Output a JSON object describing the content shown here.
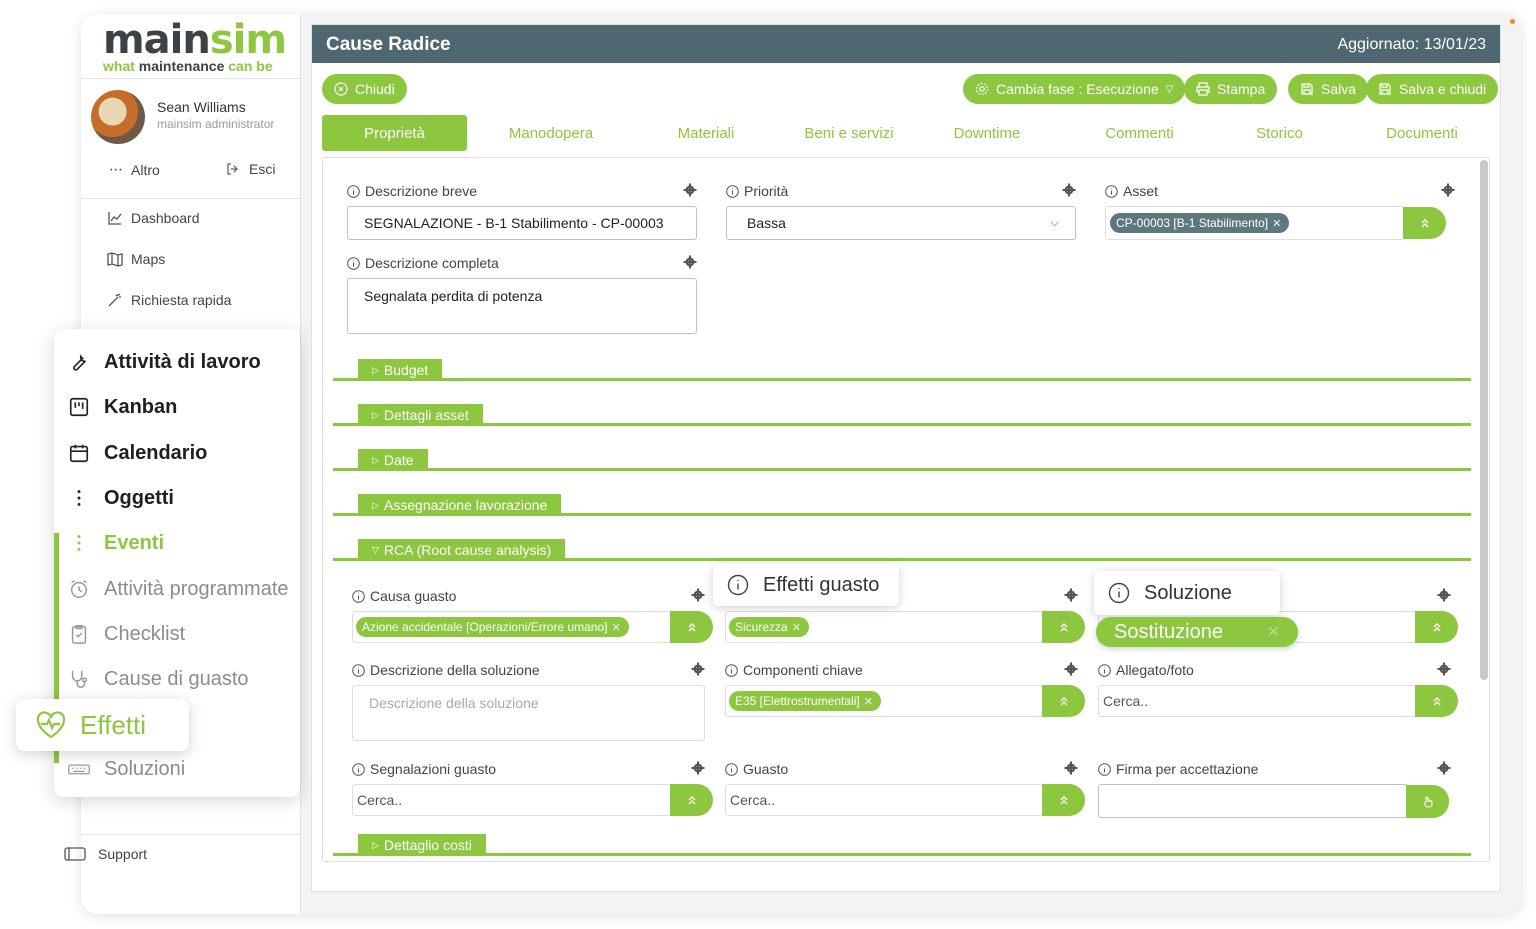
{
  "brand": {
    "logo_a": "main",
    "logo_b": "sim",
    "tagline_a": "what ",
    "tagline_b": "maintenance",
    "tagline_c": " can be"
  },
  "user": {
    "name": "Sean Williams",
    "role": "mainsim administrator"
  },
  "sidebar": {
    "more_label": "Altro",
    "logout_label": "Esci",
    "links": [
      {
        "label": "Dashboard",
        "icon": "chart-icon"
      },
      {
        "label": "Maps",
        "icon": "map-icon"
      },
      {
        "label": "Richiesta rapida",
        "icon": "wand-icon"
      }
    ],
    "support_label": "Support"
  },
  "float_menu": {
    "items": [
      {
        "label": "Attività di lavoro",
        "icon": "wrench-icon",
        "style": "dark"
      },
      {
        "label": "Kanban",
        "icon": "kanban-icon",
        "style": "dark"
      },
      {
        "label": "Calendario",
        "icon": "calendar-icon",
        "style": "dark"
      },
      {
        "label": "Oggetti",
        "icon": "dots-icon",
        "style": "dark"
      },
      {
        "label": "Eventi",
        "icon": "dots-icon",
        "style": "green"
      },
      {
        "label": "Attività programmate",
        "icon": "alarm-icon",
        "style": "grey"
      },
      {
        "label": "Checklist",
        "icon": "clipboard-icon",
        "style": "grey"
      },
      {
        "label": "Cause di guasto",
        "icon": "stethoscope-icon",
        "style": "grey"
      },
      {
        "label": "Soluzioni",
        "icon": "keyboard-icon",
        "style": "grey"
      }
    ],
    "popout_label": "Effetti"
  },
  "panel": {
    "title": "Cause Radice",
    "updated": "Aggiornato: 13/01/23",
    "buttons": {
      "close": "Chiudi",
      "phase": "Cambia fase : Esecuzione",
      "print": "Stampa",
      "save": "Salva",
      "save_close": "Salva e chiudi"
    },
    "tabs": [
      "Proprietà",
      "Manodopera",
      "Materiali",
      "Beni e servizi",
      "Downtime",
      "Commenti",
      "Storico",
      "Documenti"
    ]
  },
  "fields": {
    "short_desc": {
      "label": "Descrizione breve",
      "value": "SEGNALAZIONE - B-1 Stabilimento - CP-00003"
    },
    "priority": {
      "label": "Priorità",
      "value": "Bassa"
    },
    "asset": {
      "label": "Asset",
      "chip": "CP-00003 [B-1 Stabilimento]"
    },
    "full_desc": {
      "label": "Descrizione completa",
      "value": "Segnalata perdita di potenza"
    },
    "cause": {
      "label": "Causa guasto",
      "chip": "Azione accidentale [Operazioni/Errore umano]"
    },
    "effects": {
      "label": "Effetti guasto",
      "chip": "Sicurezza"
    },
    "solution": {
      "label": "Soluzione",
      "chip": "Sostituzione"
    },
    "solution_desc": {
      "label": "Descrizione della soluzione",
      "placeholder": "Descrizione della soluzione"
    },
    "key_components": {
      "label": "Componenti chiave",
      "chip": "E35 [Elettrostrumentali]"
    },
    "attachment": {
      "label": "Allegato/foto",
      "placeholder": "Cerca.."
    },
    "reports": {
      "label": "Segnalazioni guasto",
      "placeholder": "Cerca.."
    },
    "fault": {
      "label": "Guasto",
      "placeholder": "Cerca.."
    },
    "signature": {
      "label": "Firma per accettazione"
    }
  },
  "sections": [
    "Budget",
    "Dettagli asset",
    "Date",
    "Assegnazione lavorazione",
    "RCA (Root cause analysis)",
    "Dettaglio costi"
  ],
  "colors": {
    "accent": "#8dc63f",
    "titlebar": "#4f6770",
    "asset_chip": "#5f7880"
  }
}
